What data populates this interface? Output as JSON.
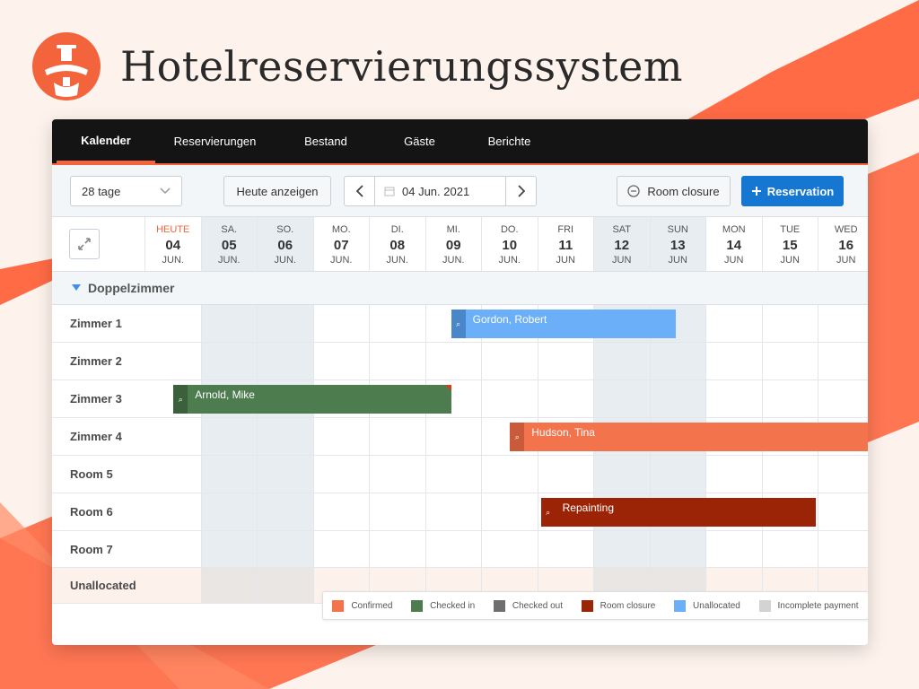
{
  "brand": {
    "title": "Hotelreservierungssystem",
    "logo_icon": "hotel-bellboy-logo-icon",
    "accent": "#f3643c"
  },
  "nav": {
    "tabs": [
      {
        "label": "Kalender",
        "active": true
      },
      {
        "label": "Reservierungen"
      },
      {
        "label": "Bestand"
      },
      {
        "label": "Gäste"
      },
      {
        "label": "Berichte"
      }
    ]
  },
  "toolbar": {
    "range_select": "28 tage",
    "today_button": "Heute anzeigen",
    "current_date": "04 Jun. 2021",
    "room_closure_button": "Room closure",
    "reservation_button": "Reservation"
  },
  "calendar": {
    "days": [
      {
        "name": "HEUTE",
        "num": "04",
        "month": "JUN.",
        "today": true,
        "weekend": false
      },
      {
        "name": "SA.",
        "num": "05",
        "month": "JUN.",
        "weekend": true
      },
      {
        "name": "SO.",
        "num": "06",
        "month": "JUN.",
        "weekend": true
      },
      {
        "name": "MO.",
        "num": "07",
        "month": "JUN.",
        "weekend": false
      },
      {
        "name": "DI.",
        "num": "08",
        "month": "JUN.",
        "weekend": false
      },
      {
        "name": "MI.",
        "num": "09",
        "month": "JUN.",
        "weekend": false
      },
      {
        "name": "DO.",
        "num": "10",
        "month": "JUN.",
        "weekend": false
      },
      {
        "name": "FRI",
        "num": "11",
        "month": "JUN",
        "weekend": false
      },
      {
        "name": "SAT",
        "num": "12",
        "month": "JUN",
        "weekend": true
      },
      {
        "name": "SUN",
        "num": "13",
        "month": "JUN",
        "weekend": true
      },
      {
        "name": "MON",
        "num": "14",
        "month": "JUN",
        "weekend": false
      },
      {
        "name": "TUE",
        "num": "15",
        "month": "JUN",
        "weekend": false
      },
      {
        "name": "WED",
        "num": "16",
        "month": "JUN",
        "weekend": false
      }
    ],
    "group": "Doppelzimmer",
    "rooms": [
      "Zimmer 1",
      "Zimmer 2",
      "Zimmer 3",
      "Zimmer 4",
      "Room 5",
      "Room 6",
      "Room 7",
      "Unallocated"
    ],
    "bookings": [
      {
        "guest": "Gordon, Robert",
        "room": 0,
        "start": 5.45,
        "end": 9.45,
        "status": "Unallocated",
        "color": "#6aaff7",
        "handle_color": "#4a87c9"
      },
      {
        "guest": "Arnold, Mike",
        "room": 2,
        "start": 0.5,
        "end": 5.45,
        "status": "Checked in",
        "color": "#4d7c4f",
        "handle_color": "#3a613b",
        "flag": true
      },
      {
        "guest": "Hudson, Tina",
        "room": 3,
        "start": 6.5,
        "end": 13,
        "status": "Confirmed",
        "color": "#f3744c",
        "handle_color": "#c95a3a"
      },
      {
        "guest": "Repainting",
        "room": 5,
        "start": 7.05,
        "end": 11.95,
        "status": "Room closure",
        "color": "#9b2407",
        "handle_color": "#9b2407"
      }
    ]
  },
  "legend": [
    {
      "label": "Confirmed",
      "color": "#f3744c"
    },
    {
      "label": "Checked in",
      "color": "#4d7c4f"
    },
    {
      "label": "Checked out",
      "color": "#6e6e6e"
    },
    {
      "label": "Room closure",
      "color": "#9b2407"
    },
    {
      "label": "Unallocated",
      "color": "#6aaff7"
    },
    {
      "label": "Incomplete payment",
      "color": "#d3d3d3"
    }
  ]
}
